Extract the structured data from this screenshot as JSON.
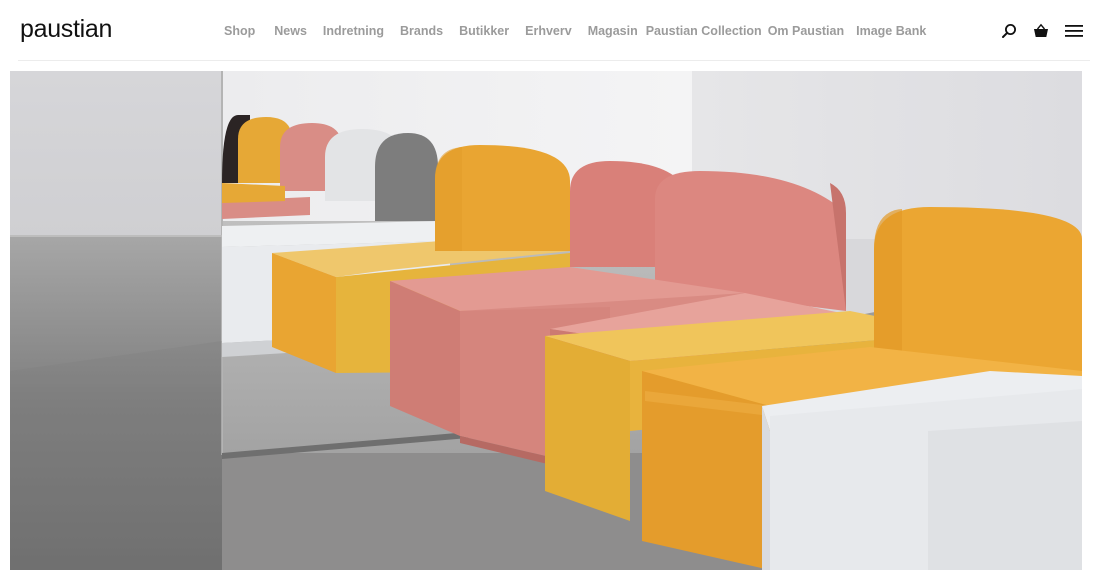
{
  "brand": {
    "logo_text": "paustian"
  },
  "nav": {
    "items": [
      {
        "label": "Shop"
      },
      {
        "label": "News"
      },
      {
        "label": "Indretning"
      },
      {
        "label": "Brands"
      },
      {
        "label": "Butikker"
      },
      {
        "label": "Erhverv"
      },
      {
        "label": "Magasin"
      },
      {
        "label": "Paustian Collection"
      },
      {
        "label": "Om Paustian"
      },
      {
        "label": "Image Bank"
      }
    ]
  },
  "icons": {
    "search": "search-icon",
    "basket": "basket-icon",
    "menu": "hamburger-menu-icon"
  },
  "colors": {
    "nav_text": "#9b9b9b",
    "logo_text": "#111111",
    "sofa_yellow": "#e6b43c",
    "sofa_orange": "#e9a532",
    "sofa_pink": "#d98b83",
    "sofa_grey": "#7a7a7a",
    "sofa_light": "#e7e9ec"
  }
}
